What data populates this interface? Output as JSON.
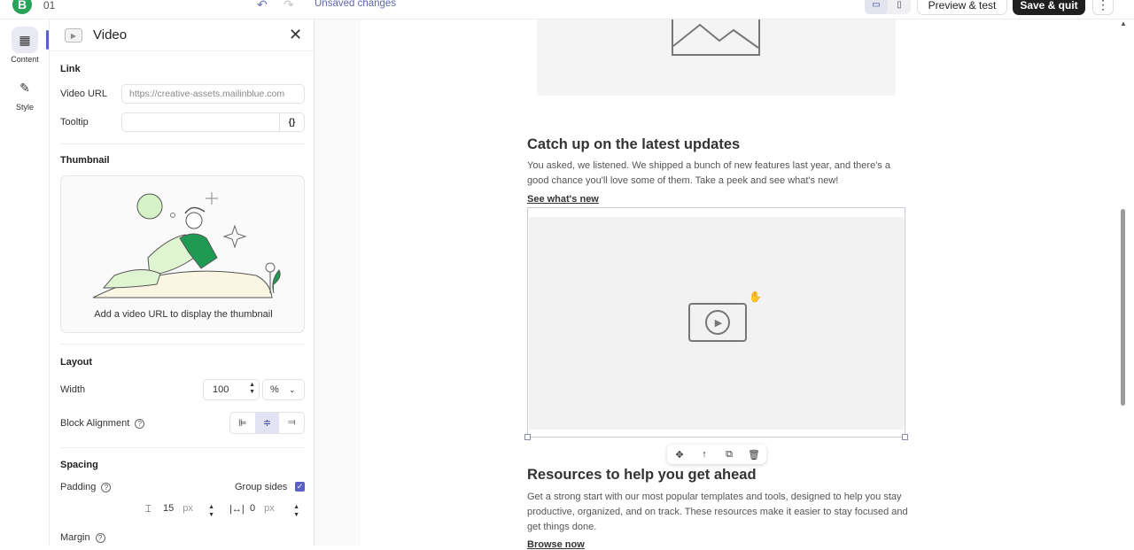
{
  "topbar": {
    "logo_letter": "B",
    "doc_name": "01",
    "undo_icon": "↶",
    "redo_icon": "↷",
    "status": "Unsaved changes",
    "preview_label": "Preview & test",
    "save_label": "Save & quit",
    "more_icon": "⋮",
    "desktop_icon": "▭",
    "mobile_icon": "▯"
  },
  "rail": {
    "items": [
      {
        "label": "Content",
        "icon": "▦"
      },
      {
        "label": "Style",
        "icon": "✎"
      }
    ]
  },
  "panel": {
    "title": "Video",
    "close_icon": "✕",
    "link": {
      "title": "Link",
      "video_url_label": "Video URL",
      "video_url_value": "https://creative-assets.mailinblue.com",
      "tooltip_label": "Tooltip",
      "tooltip_value": "",
      "braces": "{}"
    },
    "thumbnail": {
      "title": "Thumbnail",
      "caption": "Add a video URL to display the thumbnail"
    },
    "layout": {
      "title": "Layout",
      "width_label": "Width",
      "width_value": "100",
      "width_unit": "%",
      "alignment_label": "Block Alignment",
      "help": "?"
    },
    "spacing": {
      "title": "Spacing",
      "padding_label": "Padding",
      "group_sides_label": "Group sides",
      "group_sides_checked": "✓",
      "pad_vertical": "15",
      "pad_horizontal": "0",
      "unit": "px",
      "margin_label": "Margin"
    }
  },
  "email": {
    "section1": {
      "heading": "Catch up on the latest updates",
      "body": "You asked, we listened. We shipped a bunch of new features last year, and there's a good chance you'll love some of them. Take a peek and see what's new!",
      "link": "See what's new"
    },
    "section2": {
      "heading": "Resources to help you get ahead",
      "body": "Get a strong start with our most popular templates and tools, designed to help you stay productive, organized, and on track. These resources make it easier to stay focused and get things done.",
      "link": "Browse now"
    },
    "toolbar": {
      "move": "✥",
      "up": "↑",
      "duplicate": "⧉",
      "delete": "🗑"
    }
  },
  "colors": {
    "accent": "#5b5fc7",
    "brand": "#27a35a",
    "status_text": "#5b64b0"
  }
}
